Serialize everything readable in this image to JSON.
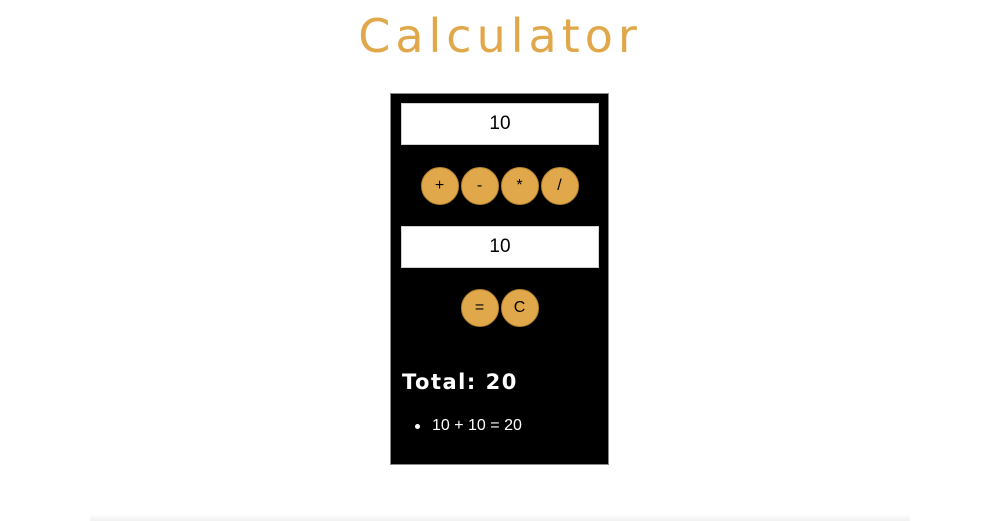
{
  "app": {
    "title": "Calculator"
  },
  "calculator": {
    "first_value": "10",
    "operators": [
      "+",
      "-",
      "*",
      "/"
    ],
    "second_value": "10",
    "equals_label": "=",
    "clear_label": "C",
    "total_label": "Total: 20",
    "history": [
      "10 + 10 = 20"
    ]
  },
  "colors": {
    "accent": "#e0a84a",
    "panel_background": "#000000",
    "page_background": "#ffffff"
  }
}
